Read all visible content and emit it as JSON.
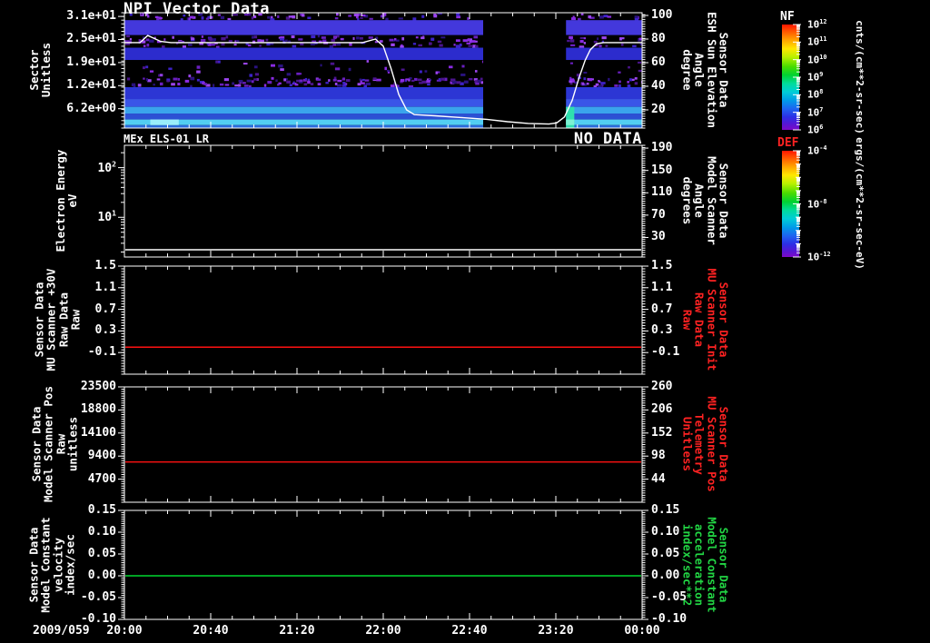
{
  "colors": {
    "background": "#000000",
    "foreground": "#ffffff",
    "red_accent": "#ff2222",
    "green_accent": "#22d544",
    "line_red": "#ff1111",
    "line_green": "#00d830",
    "line_white": "#ffffff"
  },
  "chart_data": {
    "type": "multi-panel-time-series",
    "time_axis": {
      "date": "2009/059",
      "tick_labels": [
        "20:00",
        "20:40",
        "21:20",
        "22:00",
        "22:40",
        "23:20",
        "00:00"
      ],
      "major_tick_minutes": 40,
      "minor_tick_minutes": 10,
      "span_minutes": 240
    },
    "panels": [
      {
        "id": "npi-vector-data",
        "title": "NPI Vector Data",
        "type": "spectrogram",
        "left_axis": {
          "label": "Sector\nUnitless",
          "ylim": [
            1,
            32
          ],
          "minor_step": 1,
          "ticks": [
            {
              "label": "3.1e+01",
              "value": 31
            },
            {
              "label": "2.5e+01",
              "value": 24.8
            },
            {
              "label": "1.9e+01",
              "value": 18.6
            },
            {
              "label": "1.2e+01",
              "value": 12.4
            },
            {
              "label": "6.2e+00",
              "value": 6.2
            }
          ]
        },
        "right_axis": {
          "label": "Sensor Data\nESH Sun Elevation\nAngle\ndegree",
          "color": "#ffffff",
          "ylim": [
            4.6,
            102.3
          ],
          "minor_step": 2,
          "ticks": [
            {
              "label": "100",
              "value": 100
            },
            {
              "label": "80",
              "value": 80
            },
            {
              "label": "60",
              "value": 60
            },
            {
              "label": "40",
              "value": 40
            },
            {
              "label": "20",
              "value": 20
            }
          ]
        },
        "bands": [
          {
            "s0": 30,
            "s1": 32,
            "speckle": true,
            "density": 0.28
          },
          {
            "s0": 26,
            "s1": 30,
            "color": "#4338dc"
          },
          {
            "s0": 22.6,
            "s1": 26,
            "speckle": true,
            "density": 0.32
          },
          {
            "s0": 19.3,
            "s1": 22.6,
            "color": "#2c2ccd"
          },
          {
            "s0": 14.8,
            "s1": 19.3,
            "speckle": true,
            "density": 0.08
          },
          {
            "s0": 12,
            "s1": 14.8,
            "speckle": true,
            "density": 0.42
          },
          {
            "s0": 8.8,
            "s1": 12,
            "color": "#2c36d4"
          },
          {
            "s0": 6.7,
            "s1": 8.8,
            "color": "#3a55e8"
          },
          {
            "s0": 4.9,
            "s1": 6.7,
            "color": "#3aa4ec"
          },
          {
            "s0": 3.3,
            "s1": 4.9,
            "color": "#2c50d4"
          },
          {
            "s0": 1.8,
            "s1": 3.3,
            "color": "#52cef2"
          },
          {
            "s0": 1,
            "s1": 1.8,
            "color": "#2c6cdc"
          }
        ],
        "data_gap_frac": [
          0.693,
          0.853
        ],
        "highlights": [
          {
            "x0": 0.05,
            "x1": 0.105,
            "s0": 1.8,
            "s1": 3.3,
            "color": "#9aeefb"
          },
          {
            "x0": 0.853,
            "x1": 0.869,
            "s0": 1,
            "s1": 6.7,
            "color": "#2fe0ae"
          },
          {
            "x0": 0.853,
            "x1": 0.869,
            "s0": 1.8,
            "s1": 3.3,
            "color": "#7df2d2"
          }
        ],
        "overlay_line": {
          "axis": "right",
          "color": "#ffffff",
          "points": [
            [
              0,
              77
            ],
            [
              0.03,
              77
            ],
            [
              0.045,
              83
            ],
            [
              0.07,
              78
            ],
            [
              0.09,
              77
            ],
            [
              0.46,
              77
            ],
            [
              0.485,
              80
            ],
            [
              0.5,
              74
            ],
            [
              0.515,
              55
            ],
            [
              0.53,
              33
            ],
            [
              0.545,
              20
            ],
            [
              0.56,
              16
            ],
            [
              0.6,
              15
            ],
            [
              0.65,
              13.5
            ],
            [
              0.7,
              12
            ],
            [
              0.74,
              10
            ],
            [
              0.78,
              8.5
            ],
            [
              0.82,
              8
            ],
            [
              0.835,
              9
            ],
            [
              0.85,
              14
            ],
            [
              0.865,
              28
            ],
            [
              0.878,
              47
            ],
            [
              0.89,
              62
            ],
            [
              0.9,
              71
            ],
            [
              0.912,
              76
            ],
            [
              0.925,
              77
            ],
            [
              1,
              77
            ]
          ]
        }
      },
      {
        "id": "mex-els",
        "title": "MEx ELS-01 LR",
        "status": "NO DATA",
        "type": "spectrogram-empty",
        "left_axis": {
          "label": "Electron Energy\neV",
          "log": true,
          "ylim_exp": [
            0.2,
            2.45
          ],
          "ticks": [
            {
              "label": "10^2",
              "exp": 2
            },
            {
              "label": "10^1",
              "exp": 1
            }
          ]
        },
        "right_axis": {
          "label": "Sensor Data\nModel Scanner\nAngle\ndegrees",
          "color": "#ffffff",
          "ylim": [
            -5,
            195
          ],
          "minor_step": 4,
          "ticks": [
            {
              "label": "190",
              "value": 190
            },
            {
              "label": "150",
              "value": 150
            },
            {
              "label": "110",
              "value": 110
            },
            {
              "label": "70",
              "value": 70
            },
            {
              "label": "30",
              "value": 30
            }
          ]
        },
        "flat_line": {
          "axis": "right",
          "value": 8,
          "color": "#ffffff"
        }
      },
      {
        "id": "mu-scanner-30v",
        "type": "line",
        "left_axis": {
          "label": "Sensor Data\nMU Scanner +30V\nRaw Data\nRaw",
          "ylim": [
            -0.5,
            1.5
          ],
          "minor_step": 0.05,
          "ticks": [
            {
              "label": "1.5",
              "value": 1.5
            },
            {
              "label": "1.1",
              "value": 1.1
            },
            {
              "label": "0.7",
              "value": 0.7
            },
            {
              "label": "0.3",
              "value": 0.3
            },
            {
              "label": "-0.1",
              "value": -0.1
            }
          ]
        },
        "right_axis": {
          "label": "Sensor Data\nMU Scanner Init\nRaw Data\nRaw",
          "color": "#ff2222",
          "ylim": [
            -0.5,
            1.5
          ],
          "minor_step": 0.05,
          "ticks": [
            {
              "label": "1.5",
              "value": 1.5
            },
            {
              "label": "1.1",
              "value": 1.1
            },
            {
              "label": "0.7",
              "value": 0.7
            },
            {
              "label": "0.3",
              "value": 0.3
            },
            {
              "label": "-0.1",
              "value": -0.1
            }
          ]
        },
        "flat_line": {
          "axis": "left",
          "value": 0.0,
          "color": "#ff1111"
        }
      },
      {
        "id": "model-scanner-pos",
        "type": "line",
        "left_axis": {
          "label": "Sensor Data\nModel Scanner Pos\nRaw\nunitless",
          "ylim": [
            0,
            23500
          ],
          "minor_step": 470,
          "ticks": [
            {
              "label": "23500",
              "value": 23500
            },
            {
              "label": "18800",
              "value": 18800
            },
            {
              "label": "14100",
              "value": 14100
            },
            {
              "label": "9400",
              "value": 9400
            },
            {
              "label": "4700",
              "value": 4700
            }
          ]
        },
        "right_axis": {
          "label": "Sensor Data\nMU Scanner Pos\nTelemetry\nUnitless",
          "color": "#ff2222",
          "ylim": [
            -10,
            260
          ],
          "minor_step": 5.4,
          "ticks": [
            {
              "label": "260",
              "value": 260
            },
            {
              "label": "206",
              "value": 206
            },
            {
              "label": "152",
              "value": 152
            },
            {
              "label": "98",
              "value": 98
            },
            {
              "label": "44",
              "value": 44
            }
          ]
        },
        "flat_line": {
          "axis": "left",
          "value": 8200,
          "color": "#ff1111"
        }
      },
      {
        "id": "model-constant",
        "type": "line",
        "left_axis": {
          "label": "Sensor Data\nModel Constant\nvelocity\nindex/sec",
          "ylim": [
            -0.1,
            0.15
          ],
          "minor_step": 0.005,
          "ticks": [
            {
              "label": "0.15",
              "value": 0.15
            },
            {
              "label": "0.10",
              "value": 0.1
            },
            {
              "label": "0.05",
              "value": 0.05
            },
            {
              "label": "0.00",
              "value": 0
            },
            {
              "label": "-0.05",
              "value": -0.05
            },
            {
              "label": "-0.10",
              "value": -0.1
            }
          ]
        },
        "right_axis": {
          "label": "Sensor Data\nModel Constant\nacceleration\nindex/sec**2",
          "color": "#22d544",
          "ylim": [
            -0.1,
            0.15
          ],
          "minor_step": 0.005,
          "ticks": [
            {
              "label": "0.15",
              "value": 0.15
            },
            {
              "label": "0.10",
              "value": 0.1
            },
            {
              "label": "0.05",
              "value": 0.05
            },
            {
              "label": "0.00",
              "value": 0
            },
            {
              "label": "-0.05",
              "value": -0.05
            },
            {
              "label": "-0.10",
              "value": -0.1
            }
          ]
        },
        "flat_line": {
          "axis": "left",
          "value": 0.0,
          "color": "#00d830"
        }
      }
    ],
    "colorbars": [
      {
        "id": "nf",
        "title": "NF",
        "title_color": "#ffffff",
        "unit": "cnts/(cm**2-sr-sec)",
        "exp_range": [
          6,
          12
        ],
        "tick_labels": [
          "10^12",
          "10^11",
          "10^10",
          "10^9",
          "10^8",
          "10^7",
          "10^6"
        ]
      },
      {
        "id": "def",
        "title": "DEF",
        "title_color": "#ff2222",
        "unit": "ergs/(cm**2-sr-sec-eV)",
        "exp_range": [
          -12,
          -4
        ],
        "labeled_exps": [
          -4,
          -8,
          -12
        ],
        "tick_labels": [
          "10^-4",
          "10^-8",
          "10^-12"
        ]
      }
    ]
  }
}
